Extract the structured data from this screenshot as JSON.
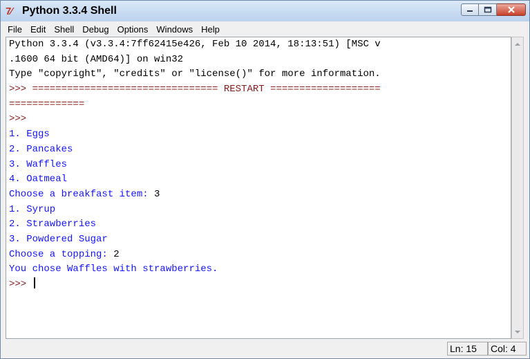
{
  "window": {
    "title": "Python 3.3.4 Shell",
    "icon": "tk-feather-icon"
  },
  "menu": [
    "File",
    "Edit",
    "Shell",
    "Debug",
    "Options",
    "Windows",
    "Help"
  ],
  "shell_lines": [
    {
      "text": "Python 3.3.4 (v3.3.4:7ff62415e426, Feb 10 2014, 18:13:51) [MSC v",
      "style": "std"
    },
    {
      "text": ".1600 64 bit (AMD64)] on win32",
      "style": "std"
    },
    {
      "text": "Type \"copyright\", \"credits\" or \"license()\" for more information.",
      "style": "std"
    },
    {
      "text": ">>> ================================ RESTART ===================",
      "style": "prompt"
    },
    {
      "text": "=============",
      "style": "prompt"
    },
    {
      "text": ">>>",
      "style": "prompt"
    },
    {
      "text": "1. Eggs",
      "style": "out"
    },
    {
      "text": "2. Pancakes",
      "style": "out"
    },
    {
      "text": "3. Waffles",
      "style": "out"
    },
    {
      "text": "4. Oatmeal",
      "style": "out"
    },
    {
      "text": "Choose a breakfast item: ",
      "style": "out",
      "input": "3"
    },
    {
      "text": "1. Syrup",
      "style": "out"
    },
    {
      "text": "2. Strawberries",
      "style": "out"
    },
    {
      "text": "3. Powdered Sugar",
      "style": "out"
    },
    {
      "text": "Choose a topping: ",
      "style": "out",
      "input": "2"
    },
    {
      "text": "You chose Waffles with strawberries.",
      "style": "out"
    },
    {
      "text": ">>> ",
      "style": "prompt",
      "cursor": true
    }
  ],
  "status": {
    "line": "Ln: 15",
    "col": "Col: 4"
  },
  "colors": {
    "output": "#1515ff",
    "prompt": "#8b1a1a",
    "text": "#000000"
  }
}
